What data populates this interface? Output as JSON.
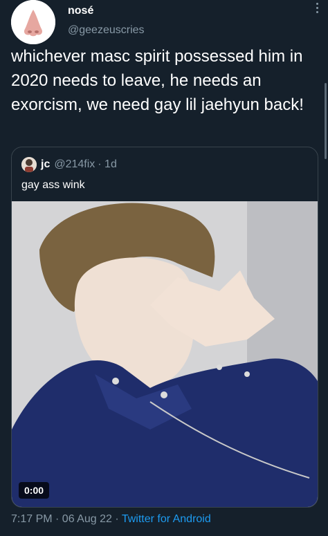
{
  "tweet": {
    "display_name": "nosé",
    "handle": "@geezeuscries",
    "text": "whichever masc spirit possessed him in 2020 needs to leave, he needs an exorcism, we need gay lil jaehyun back!"
  },
  "quoted": {
    "display_name": "jc",
    "handle": "@214fix",
    "age": "· 1d",
    "text": "gay ass wink",
    "video_time": "0:00"
  },
  "footer": {
    "time": "7:17 PM · 06 Aug 22 · ",
    "source": "Twitter for Android"
  },
  "colors": {
    "background": "#15202b",
    "link": "#1d9bf0",
    "muted": "#8899a6"
  }
}
